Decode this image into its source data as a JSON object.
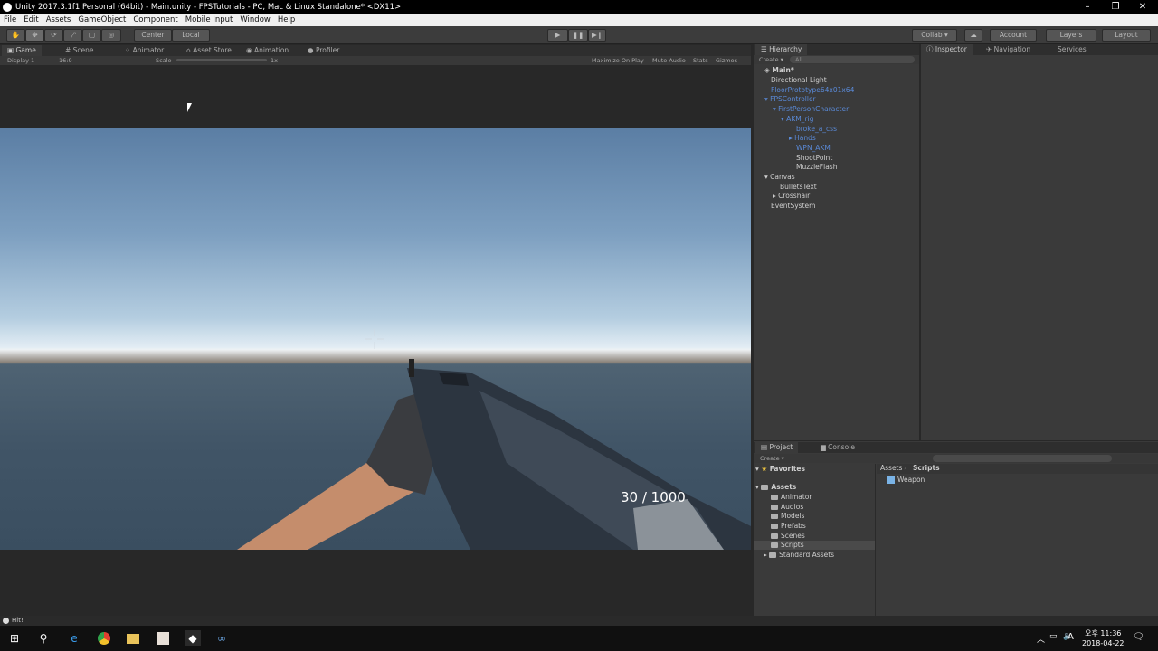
{
  "window": {
    "title": "Unity 2017.3.1f1 Personal (64bit) - Main.unity - FPSTutorials - PC, Mac & Linux Standalone* <DX11>",
    "controls": [
      "–",
      "❐",
      "✕"
    ]
  },
  "menu": [
    "File",
    "Edit",
    "Assets",
    "GameObject",
    "Component",
    "Mobile Input",
    "Window",
    "Help"
  ],
  "toolbar": {
    "pivot_label": "Center",
    "space_label": "Local",
    "collab_label": "Collab ▾",
    "account_label": "Account",
    "layers_label": "Layers",
    "layout_label": "Layout"
  },
  "scene_tabs": {
    "game": "Game",
    "scene": "Scene",
    "animator": "Animator",
    "asset_store": "Asset Store",
    "animation": "Animation",
    "profiler": "Profiler"
  },
  "game_toolbar": {
    "display": "Display 1",
    "aspect": "16:9",
    "scale_label": "Scale",
    "scale_value": "1x",
    "maximize": "Maximize On Play",
    "mute": "Mute Audio",
    "stats": "Stats",
    "gizmos": "Gizmos"
  },
  "hud": {
    "ammo": "30 / 1000"
  },
  "hierarchy": {
    "tab": "Hierarchy",
    "create": "Create ▾",
    "search_placeholder": "All",
    "scene": "Main*",
    "items": [
      {
        "label": "Directional Light",
        "color": "light"
      },
      {
        "label": "FloorPrototype64x01x64",
        "color": "blue"
      },
      {
        "label": "FPSController",
        "color": "blue"
      },
      {
        "label": "FirstPersonCharacter",
        "color": "blue"
      },
      {
        "label": "AKM_rig",
        "color": "blue"
      },
      {
        "label": "broke_a_css",
        "color": "blue"
      },
      {
        "label": "Hands",
        "color": "blue"
      },
      {
        "label": "WPN_AKM",
        "color": "blue"
      },
      {
        "label": "ShootPoint",
        "color": "light"
      },
      {
        "label": "MuzzleFlash",
        "color": "light"
      },
      {
        "label": "Canvas",
        "color": "light"
      },
      {
        "label": "BulletsText",
        "color": "light"
      },
      {
        "label": "Crosshair",
        "color": "light"
      },
      {
        "label": "EventSystem",
        "color": "light"
      }
    ]
  },
  "inspector": {
    "tabs": [
      "Inspector",
      "Navigation",
      "Services"
    ]
  },
  "project": {
    "tabs": [
      "Project",
      "Console"
    ],
    "create": "Create ▾",
    "favorites": "Favorites",
    "assets": "Assets",
    "folders": [
      "Animator",
      "Audios",
      "Models",
      "Prefabs",
      "Scenes",
      "Scripts",
      "Standard Assets"
    ],
    "breadcrumb_root": "Assets",
    "breadcrumb_current": "Scripts",
    "files": [
      "Weapon"
    ]
  },
  "status": {
    "message": "Hit!"
  },
  "taskbar": {
    "time": "오후 11:36",
    "date": "2018-04-22",
    "ime": "A"
  }
}
